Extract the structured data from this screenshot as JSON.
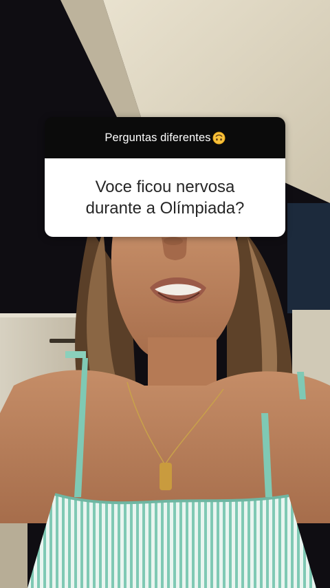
{
  "question_sticker": {
    "header": "Perguntas diferentes",
    "header_emoji": "upside-down-face-emoji",
    "question": "Voce ficou nervosa durante a Olímpiada?"
  },
  "colors": {
    "header_bg": "#0b0b0b",
    "body_bg": "#ffffff",
    "question_text": "#262626",
    "dress_stripes": "#7fc9b4"
  }
}
